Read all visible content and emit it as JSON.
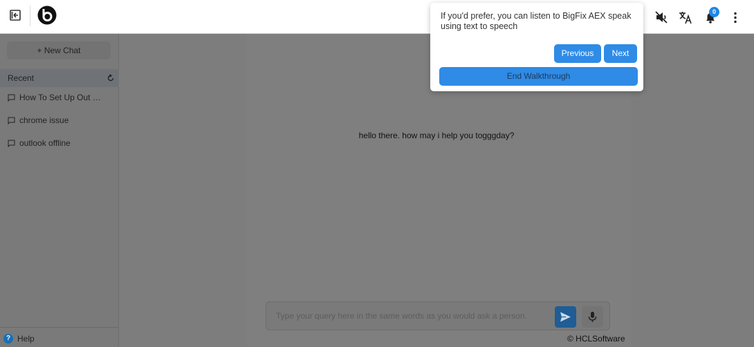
{
  "header": {
    "icons": [
      "collapse-sidebar-icon",
      "brand-logo",
      "mute-speaker-icon",
      "translate-icon",
      "bell-icon",
      "more-vertical-icon"
    ],
    "notification_count": "0"
  },
  "sidebar": {
    "new_chat_label": "+ New Chat",
    "recent_label": "Recent",
    "history": [
      {
        "label": "How To Set Up Out Of ..."
      },
      {
        "label": "chrome issue"
      },
      {
        "label": "outlook offline"
      }
    ],
    "help_label": "Help"
  },
  "main": {
    "greeting": "hello there. how may i help you togggday?",
    "query_placeholder": "Type your query here in the same words as you would ask a person.",
    "copyright": "© HCLSoftware"
  },
  "walkthrough": {
    "message": "If you'd prefer, you can listen to BigFix AEX speak using text to speech",
    "previous_label": "Previous",
    "next_label": "Next",
    "end_label": "End Walkthrough"
  },
  "colors": {
    "accent": "#2f8be6",
    "badge": "#1e88e5",
    "overlay": "#7d7d7d"
  }
}
